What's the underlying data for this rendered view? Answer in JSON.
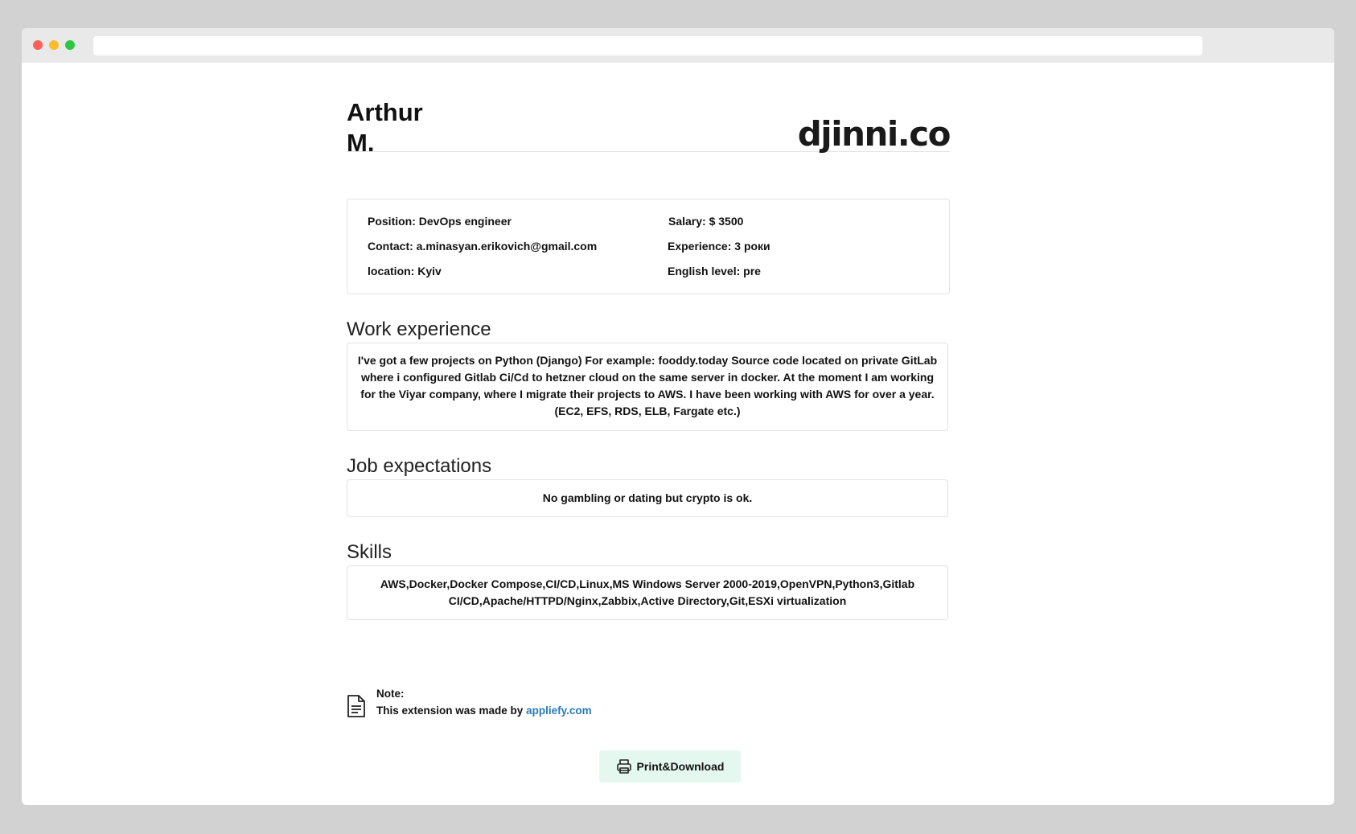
{
  "colors": {
    "background": "#d2d2d2",
    "titlebar": "#e9e9e9",
    "dot_red": "#fe5f57",
    "dot_yellow": "#febc2e",
    "dot_green": "#28c840",
    "link": "#2a7ab8",
    "button_bg": "#e4f8f0"
  },
  "profile": {
    "first_name": "Arthur",
    "last_initial": "M.",
    "logo_text": "djinni.co"
  },
  "info": {
    "position": "Position: DevOps engineer",
    "contact": "Contact: a.minasyan.erikovich@gmail.com",
    "location": "location: Kyiv",
    "salary": "Salary: $ 3500",
    "experience": "Experience: 3 роки",
    "english": "English level: pre"
  },
  "work_experience": {
    "title": "Work experience",
    "text": "I've got a few projects on Python (Django) For example: fooddy.today Source code located on private GitLab where i configured Gitlab Ci/Cd to hetzner cloud on the same server in docker. At the moment I am working for the Viyar company, where I migrate their projects to AWS. I have been working with AWS for over a year. (EC2, EFS, RDS, ELB, Fargate etc.)"
  },
  "job_expectations": {
    "title": "Job expectations",
    "text": "No gambling or dating but crypto is ok."
  },
  "skills": {
    "title": "Skills",
    "text": "AWS,Docker,Docker Compose,CI/CD,Linux,MS Windows Server 2000-2019,OpenVPN,Python3,Gitlab CI/CD,Apache/HTTPD/Nginx,Zabbix,Active Directory,Git,ESXi virtualization"
  },
  "note": {
    "icon": "document-icon",
    "title": "Note:",
    "text": "This extension was made by",
    "link_text": "appliefy.com"
  },
  "print_button": {
    "icon": "printer-icon",
    "label": "Print&Download"
  }
}
